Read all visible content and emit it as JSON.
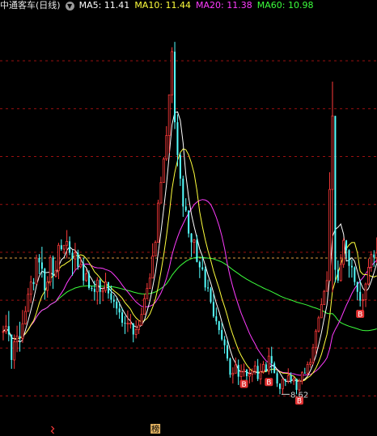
{
  "header": {
    "title": "中通客车(日线)",
    "dropdown_icon": "chevron-down-icon",
    "ma5": "MA5: 11.41",
    "ma10": "MA10: 11.44",
    "ma20": "MA20: 11.38",
    "ma60": "MA60: 10.98"
  },
  "colors": {
    "background": "#000000",
    "up": "#ff3b3b",
    "down": "#54ffff",
    "ma5": "#ffffff",
    "ma10": "#ffff3c",
    "ma20": "#ff3cff",
    "ma60": "#3cff3c",
    "grid": "#9b1010",
    "ref_line": "#e0a040",
    "marker_b": "#e23030"
  },
  "chart_data": {
    "type": "candlestick",
    "ylim": [
      8.0,
      16.4
    ],
    "reference_price": 11.4,
    "low_annotation": "8.62",
    "b_markers": [
      87,
      96,
      107,
      129
    ],
    "bottom_markers": {
      "s_icon_index": 18,
      "bang_label": "榜",
      "bang_index": 55
    },
    "candles": [
      [
        9.9,
        9.9,
        10.02,
        9.72
      ],
      [
        9.9,
        10.01,
        10.24,
        9.85
      ],
      [
        10.01,
        9.84,
        10.32,
        9.7
      ],
      [
        9.84,
        9.32,
        9.84,
        9.14
      ],
      [
        9.32,
        9.69,
        9.84,
        9.14
      ],
      [
        9.69,
        9.81,
        10.02,
        9.48
      ],
      [
        9.81,
        9.76,
        10.1,
        9.49
      ],
      [
        9.76,
        10.06,
        10.34,
        9.67
      ],
      [
        10.06,
        10.31,
        10.42,
        10.04
      ],
      [
        10.31,
        10.66,
        10.79,
        10.31
      ],
      [
        10.66,
        10.91,
        11.04,
        10.48
      ],
      [
        10.91,
        10.87,
        10.99,
        10.74
      ],
      [
        10.87,
        11.4,
        11.47,
        10.87
      ],
      [
        11.4,
        11.31,
        11.48,
        11.07
      ],
      [
        11.31,
        11.18,
        11.63,
        11.0
      ],
      [
        11.18,
        10.74,
        11.2,
        10.55
      ],
      [
        10.74,
        10.91,
        11.03,
        10.59
      ],
      [
        10.91,
        11.41,
        11.46,
        10.83
      ],
      [
        11.41,
        11.03,
        11.45,
        10.77
      ],
      [
        11.03,
        11.14,
        11.35,
        11.0
      ],
      [
        11.14,
        11.66,
        11.71,
        10.97
      ],
      [
        11.66,
        11.58,
        11.78,
        11.55
      ],
      [
        11.58,
        11.66,
        11.66,
        11.48
      ],
      [
        11.66,
        11.74,
        11.97,
        11.39
      ],
      [
        11.74,
        11.51,
        11.84,
        11.46
      ],
      [
        11.51,
        11.38,
        11.56,
        11.04
      ],
      [
        11.38,
        11.51,
        11.71,
        11.15
      ],
      [
        11.51,
        11.22,
        11.57,
        11.16
      ],
      [
        11.22,
        11.27,
        11.43,
        11.19
      ],
      [
        11.27,
        10.94,
        11.41,
        10.84
      ],
      [
        10.94,
        11.08,
        11.17,
        10.91
      ],
      [
        11.08,
        10.79,
        11.15,
        10.75
      ],
      [
        10.79,
        10.77,
        10.83,
        10.72
      ],
      [
        10.77,
        10.71,
        10.94,
        10.53
      ],
      [
        10.71,
        10.95,
        11.01,
        10.45
      ],
      [
        10.95,
        10.71,
        10.98,
        10.46
      ],
      [
        10.71,
        10.74,
        10.8,
        10.52
      ],
      [
        10.74,
        10.91,
        11.1,
        10.69
      ],
      [
        10.91,
        10.68,
        10.91,
        10.57
      ],
      [
        10.68,
        10.55,
        10.84,
        10.48
      ],
      [
        10.55,
        10.51,
        10.64,
        10.38
      ],
      [
        10.51,
        10.37,
        10.58,
        10.24
      ],
      [
        10.37,
        10.29,
        10.51,
        10.16
      ],
      [
        10.29,
        10.08,
        10.38,
        10.0
      ],
      [
        10.08,
        10.06,
        10.22,
        9.85
      ],
      [
        10.06,
        10.07,
        10.33,
        9.89
      ],
      [
        10.07,
        10.07,
        10.26,
        9.96
      ],
      [
        10.07,
        9.84,
        10.07,
        9.68
      ],
      [
        9.84,
        9.94,
        10.13,
        9.76
      ],
      [
        9.94,
        10.03,
        10.14,
        9.85
      ],
      [
        10.03,
        10.25,
        10.39,
        10.03
      ],
      [
        10.25,
        10.57,
        10.67,
        10.25
      ],
      [
        10.57,
        10.78,
        10.89,
        10.57
      ],
      [
        10.78,
        10.99,
        11.09,
        10.78
      ],
      [
        10.99,
        11.44,
        11.7,
        10.99
      ],
      [
        11.44,
        11.72,
        11.76,
        11.44
      ],
      [
        11.72,
        12.52,
        12.59,
        11.72
      ],
      [
        12.52,
        12.94,
        13.06,
        12.52
      ],
      [
        12.94,
        13.42,
        13.46,
        12.94
      ],
      [
        13.42,
        13.9,
        14.09,
        13.38
      ],
      [
        13.9,
        14.73,
        14.73,
        13.54
      ],
      [
        14.73,
        15.61,
        15.7,
        14.56
      ],
      [
        15.61,
        14.17,
        15.81,
        14.03
      ],
      [
        14.17,
        13.5,
        14.33,
        13.27
      ],
      [
        13.5,
        13.02,
        13.55,
        12.87
      ],
      [
        13.02,
        12.45,
        13.08,
        12.24
      ],
      [
        12.45,
        12.37,
        12.62,
        12.34
      ],
      [
        12.37,
        11.9,
        12.37,
        11.82
      ],
      [
        11.9,
        11.72,
        11.91,
        11.42
      ],
      [
        11.72,
        11.77,
        11.79,
        11.49
      ],
      [
        11.77,
        11.32,
        11.87,
        11.31
      ],
      [
        11.32,
        11.21,
        11.35,
        10.99
      ],
      [
        11.21,
        11.17,
        11.44,
        11.14
      ],
      [
        11.17,
        10.8,
        11.23,
        10.73
      ],
      [
        10.8,
        10.78,
        10.96,
        10.71
      ],
      [
        10.78,
        10.5,
        10.81,
        10.47
      ],
      [
        10.5,
        10.21,
        10.67,
        10.18
      ],
      [
        10.21,
        10.11,
        10.39,
        10.04
      ],
      [
        10.11,
        9.93,
        10.12,
        9.84
      ],
      [
        9.93,
        9.74,
        10.08,
        9.71
      ],
      [
        9.74,
        9.62,
        9.81,
        9.45
      ],
      [
        9.62,
        9.35,
        9.72,
        9.3
      ],
      [
        9.35,
        9.02,
        9.37,
        8.96
      ],
      [
        9.02,
        9.05,
        9.17,
        8.84
      ],
      [
        9.05,
        9.22,
        9.37,
        9.05
      ],
      [
        9.22,
        8.98,
        9.33,
        8.81
      ],
      [
        8.98,
        9.08,
        9.23,
        8.86
      ],
      [
        9.08,
        9.12,
        9.25,
        8.98
      ],
      [
        9.12,
        8.99,
        9.14,
        8.88
      ],
      [
        8.99,
        9.03,
        9.17,
        8.84
      ],
      [
        9.03,
        9.09,
        9.15,
        8.87
      ],
      [
        9.09,
        9.2,
        9.3,
        9.02
      ],
      [
        9.2,
        8.93,
        9.34,
        8.89
      ],
      [
        8.93,
        9.08,
        9.25,
        8.82
      ],
      [
        9.08,
        9.23,
        9.3,
        9.04
      ],
      [
        9.23,
        9.09,
        9.28,
        9.07
      ],
      [
        9.09,
        9.4,
        9.57,
        9.02
      ],
      [
        9.4,
        9.25,
        9.59,
        9.05
      ],
      [
        9.25,
        9.05,
        9.29,
        9.05
      ],
      [
        9.05,
        8.84,
        9.09,
        8.77
      ],
      [
        8.84,
        8.73,
        8.84,
        8.62
      ],
      [
        8.73,
        8.93,
        8.93,
        8.62
      ],
      [
        8.93,
        8.89,
        8.93,
        8.79
      ],
      [
        8.89,
        9.0,
        9.15,
        8.84
      ],
      [
        9.0,
        8.89,
        9.07,
        8.84
      ],
      [
        8.89,
        8.94,
        8.98,
        8.81
      ],
      [
        8.94,
        8.71,
        8.94,
        8.62
      ],
      [
        8.71,
        8.89,
        8.94,
        8.64
      ],
      [
        8.89,
        9.06,
        9.09,
        8.82
      ],
      [
        9.06,
        9.05,
        9.16,
        9.04
      ],
      [
        9.05,
        9.23,
        9.29,
        9.0
      ],
      [
        9.23,
        9.27,
        9.35,
        9.16
      ],
      [
        9.27,
        9.57,
        9.65,
        9.22
      ],
      [
        9.57,
        9.91,
        9.95,
        9.43
      ],
      [
        9.91,
        10.18,
        10.22,
        9.88
      ],
      [
        10.18,
        10.45,
        10.58,
        10.18
      ],
      [
        10.45,
        10.72,
        10.75,
        10.45
      ],
      [
        10.72,
        10.94,
        11.13,
        10.72
      ],
      [
        10.94,
        12.8,
        13.15,
        10.94
      ],
      [
        12.8,
        14.3,
        15.0,
        10.7
      ],
      [
        14.3,
        11.16,
        14.3,
        10.9
      ],
      [
        11.16,
        10.94,
        11.35,
        10.89
      ],
      [
        10.94,
        11.27,
        11.48,
        10.92
      ],
      [
        11.27,
        11.76,
        11.81,
        11.2
      ],
      [
        11.76,
        11.56,
        11.77,
        11.4
      ],
      [
        11.56,
        11.24,
        11.58,
        11.0
      ],
      [
        11.24,
        11.21,
        11.37,
        11.0
      ],
      [
        11.21,
        10.91,
        11.23,
        10.84
      ],
      [
        10.91,
        10.71,
        10.92,
        10.54
      ],
      [
        10.71,
        10.53,
        10.96,
        10.41
      ],
      [
        10.53,
        10.55,
        10.67,
        10.28
      ],
      [
        10.55,
        10.87,
        10.9,
        10.4
      ],
      [
        10.87,
        11.21,
        11.39,
        10.84
      ],
      [
        11.21,
        11.47,
        11.54,
        11.12
      ],
      [
        11.47,
        11.41,
        11.56,
        11.22
      ],
      [
        11.41,
        11.5,
        11.82,
        11.3
      ]
    ]
  }
}
